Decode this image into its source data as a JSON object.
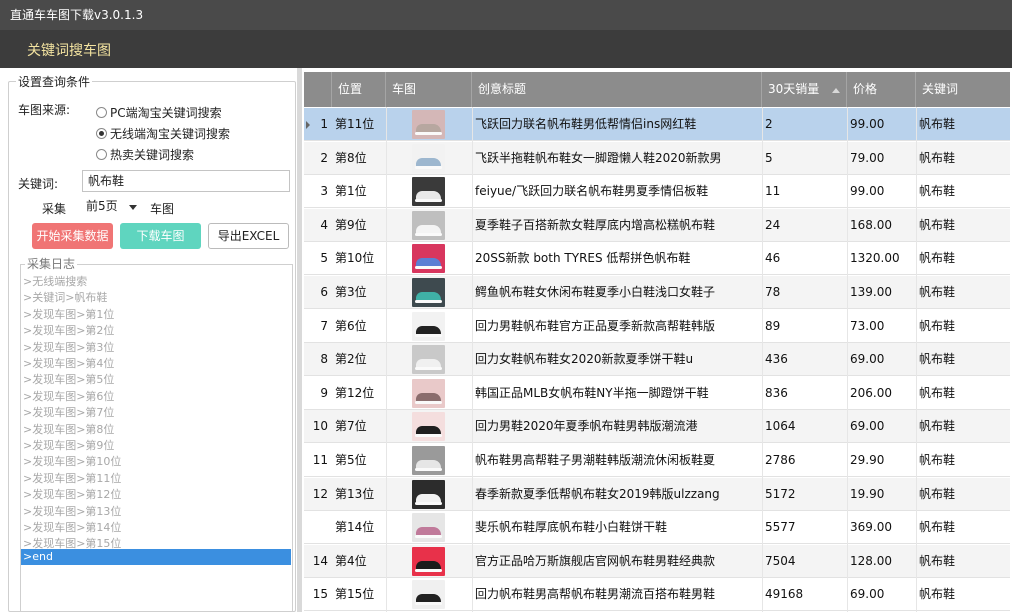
{
  "window": {
    "title": "直通车车图下载v3.0.1.3"
  },
  "section": {
    "title": "关键词搜车图"
  },
  "left": {
    "legend": "设置查询条件",
    "source_label": "车图来源:",
    "radios": [
      {
        "label": "PC端淘宝关键词搜索",
        "checked": false
      },
      {
        "label": "无线端淘宝关键词搜索",
        "checked": true
      },
      {
        "label": "热卖关键词搜索",
        "checked": false
      }
    ],
    "keyword_label": "关键词:",
    "keyword_value": "帆布鞋",
    "collect_label": "采集",
    "pages_selected": "前5页",
    "unit_label": "车图",
    "buttons": {
      "start": "开始采集数据",
      "download": "下载车图",
      "export": "导出EXCEL"
    },
    "log_legend": "采集日志",
    "log_lines": [
      ">无线端搜索",
      ">关键词>帆布鞋",
      ">发现车图>第1位",
      ">发现车图>第2位",
      ">发现车图>第3位",
      ">发现车图>第4位",
      ">发现车图>第5位",
      ">发现车图>第6位",
      ">发现车图>第7位",
      ">发现车图>第8位",
      ">发现车图>第9位",
      ">发现车图>第10位",
      ">发现车图>第11位",
      ">发现车图>第12位",
      ">发现车图>第13位",
      ">发现车图>第14位",
      ">发现车图>第15位",
      ">end"
    ]
  },
  "table": {
    "columns": [
      "位置",
      "车图",
      "创意标题",
      "30天销量",
      "价格",
      "关键词"
    ],
    "rows": [
      {
        "num": "1",
        "pos": "第11位",
        "title": "飞跃回力联名帆布鞋男低帮情侣ins网红鞋",
        "sales": "2",
        "price": "99.00",
        "kw": "帆布鞋",
        "thumb": "#d4b7b7",
        "shoe": "#b7a7a0"
      },
      {
        "num": "2",
        "pos": "第8位",
        "title": "飞跃半拖鞋帆布鞋女一脚蹬懒人鞋2020新款男",
        "sales": "5",
        "price": "79.00",
        "kw": "帆布鞋",
        "thumb": "#f2f2f2",
        "shoe": "#9db7cf"
      },
      {
        "num": "3",
        "pos": "第1位",
        "title": "feiyue/飞跃回力联名帆布鞋男夏季情侣板鞋",
        "sales": "11",
        "price": "99.00",
        "kw": "帆布鞋",
        "thumb": "#3a3a3a",
        "shoe": "#e9e9e9"
      },
      {
        "num": "4",
        "pos": "第9位",
        "title": "夏季鞋子百搭新款女鞋厚底内增高松糕帆布鞋",
        "sales": "24",
        "price": "168.00",
        "kw": "帆布鞋",
        "thumb": "#bfbfbf",
        "shoe": "#f4f4f4"
      },
      {
        "num": "5",
        "pos": "第10位",
        "title": "20SS新款 both TYRES 低帮拼色帆布鞋",
        "sales": "46",
        "price": "1320.00",
        "kw": "帆布鞋",
        "thumb": "#d8365e",
        "shoe": "#5b7fd4"
      },
      {
        "num": "6",
        "pos": "第3位",
        "title": "鳄鱼帆布鞋女休闲布鞋夏季小白鞋浅口女鞋子",
        "sales": "78",
        "price": "139.00",
        "kw": "帆布鞋",
        "thumb": "#3e4a4f",
        "shoe": "#3fb0a6"
      },
      {
        "num": "7",
        "pos": "第6位",
        "title": "回力男鞋帆布鞋官方正品夏季新款高帮鞋韩版",
        "sales": "89",
        "price": "73.00",
        "kw": "帆布鞋",
        "thumb": "#f2f2f2",
        "shoe": "#222222"
      },
      {
        "num": "8",
        "pos": "第2位",
        "title": "回力女鞋帆布鞋女2020新款夏季饼干鞋u",
        "sales": "436",
        "price": "69.00",
        "kw": "帆布鞋",
        "thumb": "#c9c9c9",
        "shoe": "#f0f0f0"
      },
      {
        "num": "9",
        "pos": "第12位",
        "title": "韩国正品MLB女帆布鞋NY半拖一脚蹬饼干鞋",
        "sales": "836",
        "price": "206.00",
        "kw": "帆布鞋",
        "thumb": "#e9c9c9",
        "shoe": "#8a6d6d"
      },
      {
        "num": "10",
        "pos": "第7位",
        "title": "回力男鞋2020年夏季帆布鞋男韩版潮流港",
        "sales": "1064",
        "price": "69.00",
        "kw": "帆布鞋",
        "thumb": "#f4dede",
        "shoe": "#1f1f1f"
      },
      {
        "num": "11",
        "pos": "第5位",
        "title": "帆布鞋男高帮鞋子男潮鞋韩版潮流休闲板鞋夏",
        "sales": "2786",
        "price": "29.90",
        "kw": "帆布鞋",
        "thumb": "#9a9a9a",
        "shoe": "#e6e6e6"
      },
      {
        "num": "12",
        "pos": "第13位",
        "title": "春季新款夏季低帮帆布鞋女2019韩版ulzzang",
        "sales": "5172",
        "price": "19.90",
        "kw": "帆布鞋",
        "thumb": "#2c2c2c",
        "shoe": "#f2f2f2"
      },
      {
        "num": "",
        "pos": "第14位",
        "title": "斐乐帆布鞋厚底帆布鞋小白鞋饼干鞋",
        "sales": "5577",
        "price": "369.00",
        "kw": "帆布鞋",
        "thumb": "#e6e6e6",
        "shoe": "#c07a9a"
      },
      {
        "num": "14",
        "pos": "第4位",
        "title": "官方正品哈万斯旗舰店官网帆布鞋男鞋经典款",
        "sales": "7504",
        "price": "128.00",
        "kw": "帆布鞋",
        "thumb": "#e8314a",
        "shoe": "#1c1c1c"
      },
      {
        "num": "15",
        "pos": "第15位",
        "title": "回力帆布鞋男高帮帆布鞋男潮流百搭布鞋男鞋",
        "sales": "49168",
        "price": "69.00",
        "kw": "帆布鞋",
        "thumb": "#f0f0f0",
        "shoe": "#222222"
      }
    ]
  }
}
